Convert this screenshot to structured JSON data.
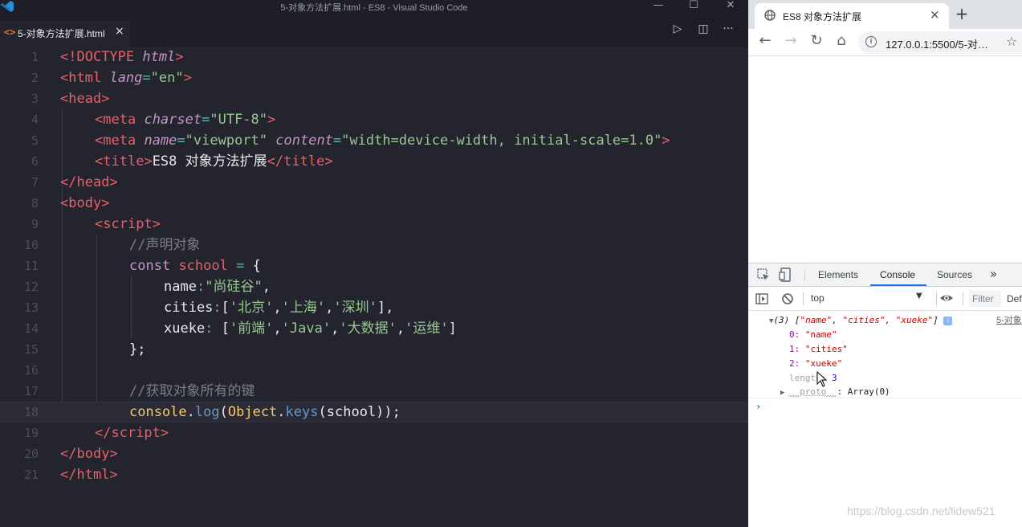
{
  "vscode": {
    "window_title": "5-对象方法扩展.html - ES8 - Visual Studio Code",
    "tab": {
      "icon": "html-file-icon",
      "label": "5-对象方法扩展.html",
      "close": "×"
    },
    "actions": {
      "run": "▷",
      "split": "◫",
      "more": "···"
    },
    "window_controls": {
      "minimize": "—",
      "maximize": "☐",
      "close": "✕"
    },
    "line_numbers": [
      "1",
      "2",
      "3",
      "4",
      "5",
      "6",
      "7",
      "8",
      "9",
      "10",
      "11",
      "12",
      "13",
      "14",
      "15",
      "16",
      "17",
      "18",
      "19",
      "20",
      "21"
    ],
    "code": {
      "l1": [
        "<!",
        "DOCTYPE",
        " ",
        "html",
        ">"
      ],
      "l2": [
        "<",
        "html",
        " ",
        "lang",
        "=",
        "\"en\"",
        ">"
      ],
      "l3": [
        "<",
        "head",
        ">"
      ],
      "l4": [
        "<",
        "meta",
        " ",
        "charset",
        "=",
        "\"UTF-8\"",
        ">"
      ],
      "l5": [
        "<",
        "meta",
        " ",
        "name",
        "=",
        "\"viewport\"",
        " ",
        "content",
        "=",
        "\"width=device-width, initial-scale=1.0\"",
        ">"
      ],
      "l6": [
        "<",
        "title",
        ">",
        "ES8 对象方法扩展",
        "</",
        "title",
        ">"
      ],
      "l7": [
        "</",
        "head",
        ">"
      ],
      "l8": [
        "<",
        "body",
        ">"
      ],
      "l9": [
        "<",
        "script",
        ">"
      ],
      "l10": "//声明对象",
      "l11": [
        "const",
        " ",
        "school",
        " ",
        "=",
        " ",
        "{"
      ],
      "l12": [
        "name",
        ":",
        "\"尚硅谷\"",
        ","
      ],
      "l13": [
        "cities",
        ":",
        "[",
        "'北京'",
        ",",
        "'上海'",
        ",",
        "'深圳'",
        "]",
        ","
      ],
      "l14": [
        "xueke",
        ":",
        " ",
        "[",
        "'前端'",
        ",",
        "'Java'",
        ",",
        "'大数据'",
        ",",
        "'运维'",
        "]"
      ],
      "l15": [
        "}",
        ";"
      ],
      "l17": "//获取对象所有的键",
      "l18": [
        "console",
        ".",
        "log",
        "(",
        "Object",
        ".",
        "keys",
        "(",
        "school",
        ")",
        ")",
        ";"
      ],
      "l19": [
        "</",
        "script",
        ">"
      ],
      "l20": [
        "</",
        "body",
        ">"
      ],
      "l21": [
        "</",
        "html",
        ">"
      ]
    }
  },
  "browser": {
    "tab_title": "ES8 对象方法扩展",
    "tab_close": "×",
    "new_tab": "+",
    "nav": {
      "back": "←",
      "forward": "→",
      "reload": "↻",
      "home": "⌂"
    },
    "url": "127.0.0.1:5500/5-对…",
    "info_icon": "i",
    "star": "☆"
  },
  "devtools": {
    "tabs": [
      "Elements",
      "Console",
      "Sources"
    ],
    "active_tab": "Console",
    "more": "»",
    "context": "top",
    "filter_placeholder": "Filter",
    "levels": "Def",
    "log": {
      "summary_prefix": "(3) [",
      "summary_items": [
        "\"name\"",
        "\"cities\"",
        "\"xueke\""
      ],
      "summary_suffix": "]",
      "source": "5-对象",
      "entries": [
        {
          "key": "0",
          "value": "\"name\""
        },
        {
          "key": "1",
          "value": "\"cities\""
        },
        {
          "key": "2",
          "value": "\"xueke\""
        }
      ],
      "length_key": "length",
      "length_value": "3",
      "proto_key": "__proto__",
      "proto_value": "Array(0)"
    },
    "prompt": "›"
  },
  "watermark": "https://blog.csdn.net/lidew521",
  "colors": {
    "editor_bg": "#23242e",
    "tag": "#ec5f67",
    "attr": "#c594c5",
    "string": "#99c794",
    "comment": "#7a7d89",
    "function": "#6699cc",
    "devtools_accent": "#1a73e8"
  }
}
